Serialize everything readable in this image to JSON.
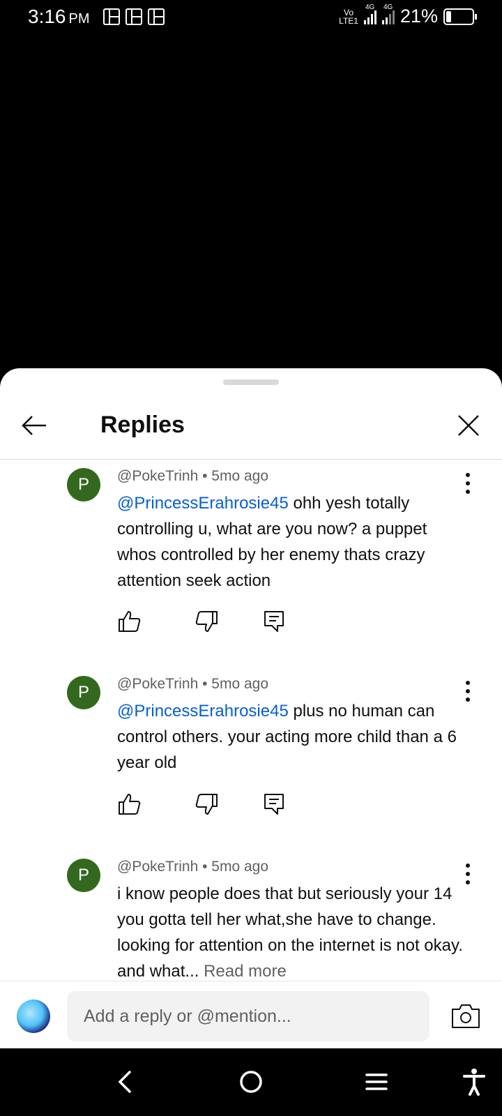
{
  "status_bar": {
    "time": "3:16",
    "ampm": "PM",
    "network_top": "Vo",
    "network_bottom": "LTE1",
    "sig1": "4G",
    "sig2": "4G",
    "battery": "21%",
    "battery_level": 0.21
  },
  "header": {
    "title": "Replies",
    "back_icon": "arrow-left-icon",
    "close_icon": "close-icon"
  },
  "comments": [
    {
      "avatar_letter": "P",
      "author": "@PokeTrinh",
      "time": "5mo ago",
      "mention": "@PrincessErahrosie45",
      "text": "ohh yesh totally controlling u, what are you now? a puppet whos controlled by her enemy thats crazy attention seek action"
    },
    {
      "avatar_letter": "P",
      "author": "@PokeTrinh",
      "time": "5mo ago",
      "mention": "@PrincessErahrosie45",
      "text": "plus no human can control others. your acting more child than a 6 year old"
    },
    {
      "avatar_letter": "P",
      "author": "@PokeTrinh",
      "time": "5mo ago",
      "text": "i know people does that but seriously your 14 you gotta tell her what,she have to change. looking for attention on the internet is not okay. and what...",
      "read_more": "Read more"
    }
  ],
  "meta_separator": "•",
  "composer": {
    "placeholder": "Add a reply or @mention..."
  }
}
